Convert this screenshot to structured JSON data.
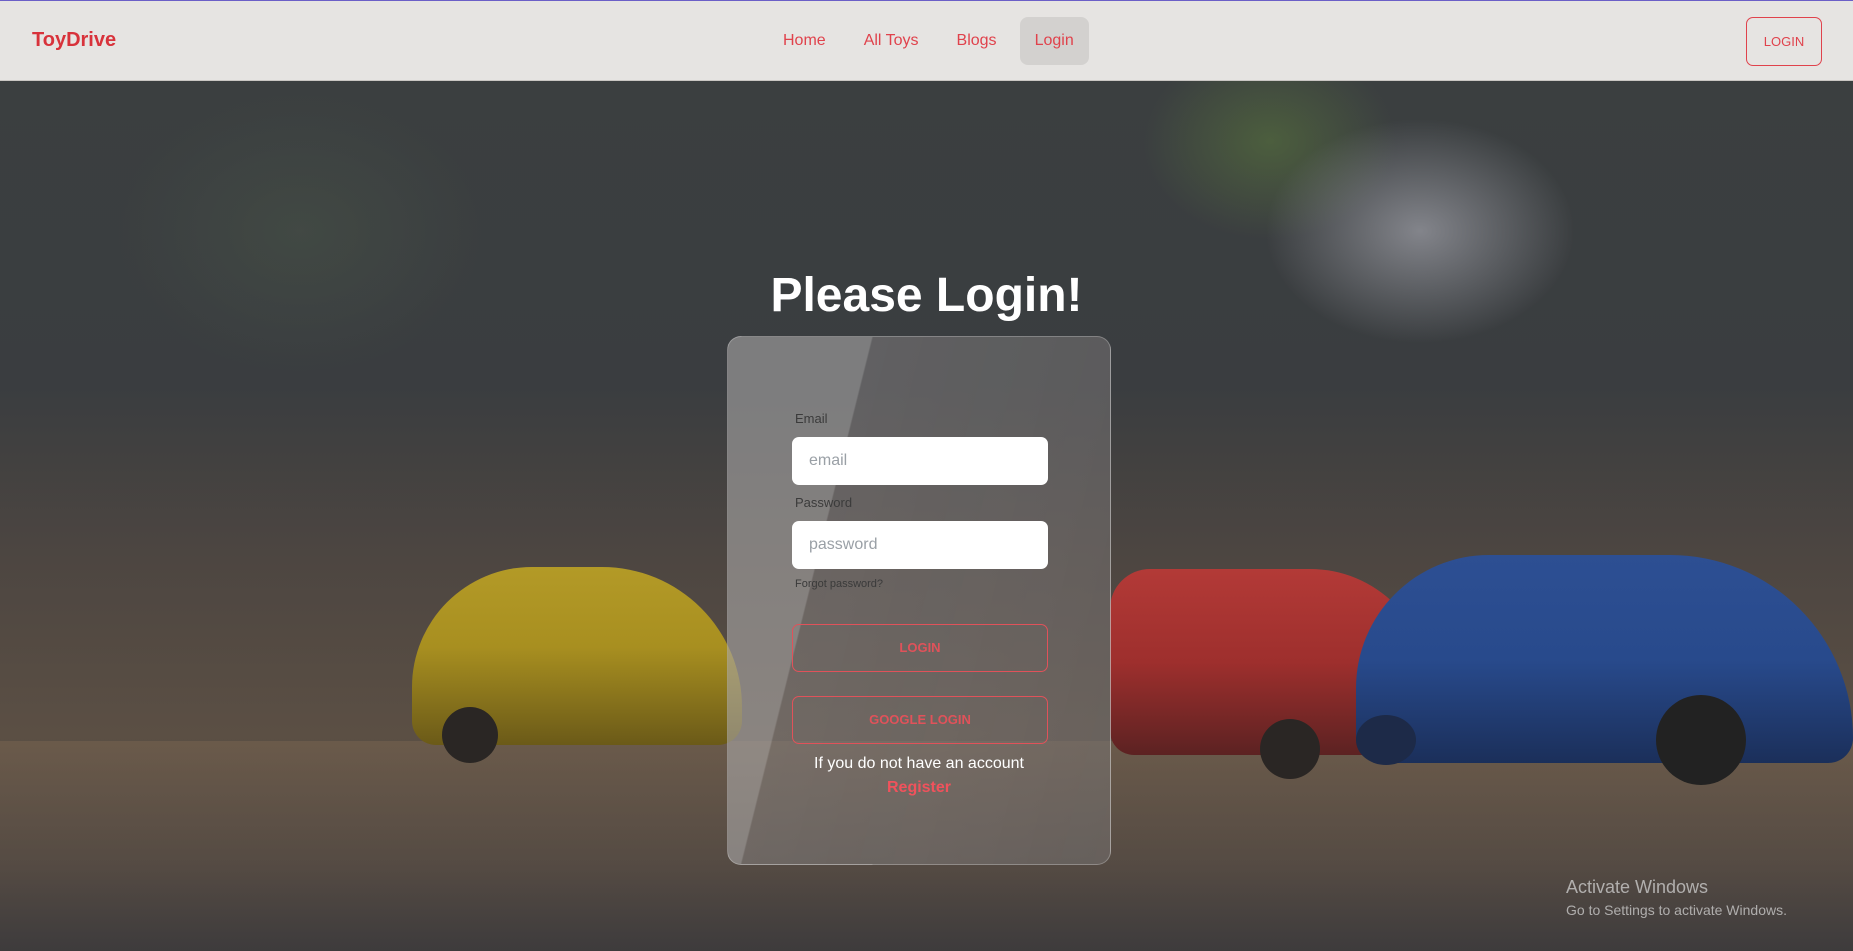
{
  "navbar": {
    "brand": "ToyDrive",
    "links": [
      {
        "label": "Home"
      },
      {
        "label": "All Toys"
      },
      {
        "label": "Blogs"
      },
      {
        "label": "Login"
      }
    ],
    "active_link": "Login",
    "login_button": "LOGIN"
  },
  "login": {
    "title": "Please Login!",
    "email_label": "Email",
    "email_placeholder": "email",
    "password_label": "Password",
    "password_placeholder": "password",
    "forgot_password": "Forgot password?",
    "login_button": "LOGIN",
    "google_button": "GOOGLE LOGIN",
    "no_account_text": "If you do not have an account",
    "register_link": "Register"
  },
  "watermark": {
    "title": "Activate Windows",
    "subtitle": "Go to Settings to activate Windows."
  },
  "colors": {
    "accent": "#e0424c",
    "brand": "#d8323b",
    "navbar_bg": "#e6e4e2"
  }
}
